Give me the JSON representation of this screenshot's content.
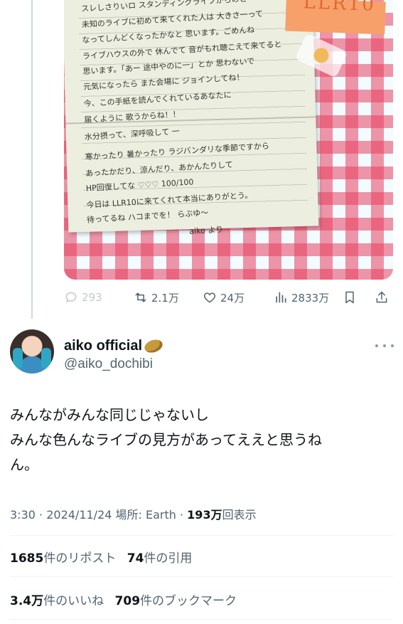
{
  "actions": {
    "reply": {
      "icon": "reply-icon",
      "count": "293"
    },
    "repost": {
      "icon": "repost-icon",
      "count": "2.1万"
    },
    "like": {
      "icon": "heart-icon",
      "count": "24万"
    },
    "views": {
      "icon": "analytics-icon",
      "count": "2833万"
    },
    "bookmark": {
      "icon": "bookmark-icon"
    },
    "share": {
      "icon": "share-icon"
    }
  },
  "photo": {
    "sticky_text": "LLR10",
    "letter_lines": [
      "スレしさりいロ スタンディングライブからのと",
      "未知のライブに初めて来てくれた人は 大きさ一って",
      "なってしんどくなったかなと 思います。ごめんね",
      "ライブハウスの外で 休んでて 音がもれ聴こえて来てると",
      "思います。「あー 途中やのに一」とか 思わないで",
      "元気になったら また会場に ジョインしてね！",
      "今、この手紙を読んでくれているあなたに",
      "届くように 歌うからね！！",
      "水分摂って、深呼吸して 一",
      "寒かったり 暑かったり ラジバンダリな季節ですから",
      "あったかだり、涼んだり、あかんたりして",
      "HP回復してな ♡♡♡ 100/100",
      "今日は LLR10に来てくれて本当にありがとう。",
      "待ってるね ハコまでを！ らぶゆ〜",
      "aiko より"
    ]
  },
  "tweet": {
    "display_name": "aiko official",
    "handle": "@aiko_dochibi",
    "text_lines": [
      "みんながみんな同じじゃないし",
      "みんな色んなライブの見方があってええと思うね",
      "ん。"
    ],
    "time": "3:30",
    "date": "2024/11/24",
    "location_label": "場所: Earth",
    "views_count": "193万",
    "views_label": "回表示",
    "reposts_count": "1685",
    "reposts_label": "件のリポスト",
    "quotes_count": "74",
    "quotes_label": "件の引用",
    "likes_count": "3.4万",
    "likes_label": "件のいいね",
    "bookmarks_count": "709",
    "bookmarks_label": "件のブックマーク"
  },
  "colors": {
    "text_primary": "#0f1419",
    "text_secondary": "#536471",
    "divider": "#eff3f4",
    "thread_line": "#cfd9de",
    "gingham_red": "#e84060"
  }
}
